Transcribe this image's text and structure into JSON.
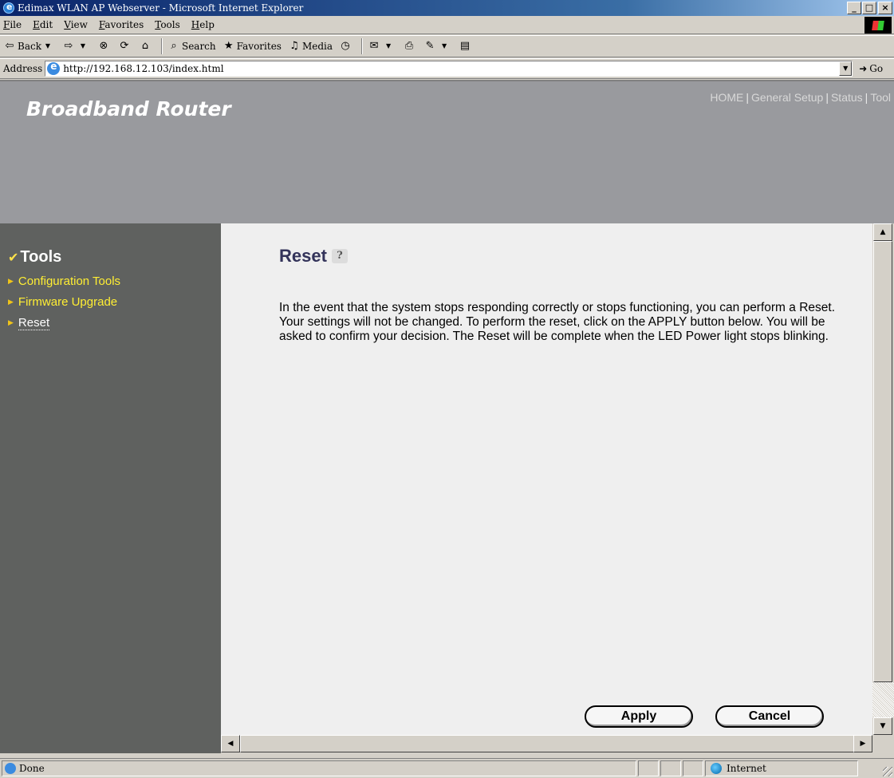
{
  "window": {
    "title": "Edimax WLAN AP Webserver - Microsoft Internet Explorer",
    "minimize": "_",
    "maximize": "□",
    "close": "×"
  },
  "menu": [
    "File",
    "Edit",
    "View",
    "Favorites",
    "Tools",
    "Help"
  ],
  "toolbar": {
    "back": "Back",
    "search": "Search",
    "favorites": "Favorites",
    "media": "Media"
  },
  "address": {
    "label": "Address",
    "url": "http://192.168.12.103/index.html",
    "go": "Go"
  },
  "header": {
    "brand": "Broadband Router",
    "nav": [
      "HOME",
      "General Setup",
      "Status",
      "Tool"
    ]
  },
  "sidebar": {
    "title": "Tools",
    "items": [
      {
        "label": "Configuration Tools"
      },
      {
        "label": "Firmware Upgrade"
      },
      {
        "label": "Reset"
      }
    ]
  },
  "main": {
    "title": "Reset",
    "description": "In the event that the system stops responding correctly or stops functioning, you can perform a Reset. Your settings will not be changed. To perform the reset, click on the APPLY button below. You will be asked to confirm your decision. The Reset will be complete when the LED Power light stops blinking.",
    "apply_label": "Apply",
    "cancel_label": "Cancel"
  },
  "status": {
    "text": "Done",
    "zone": "Internet"
  }
}
